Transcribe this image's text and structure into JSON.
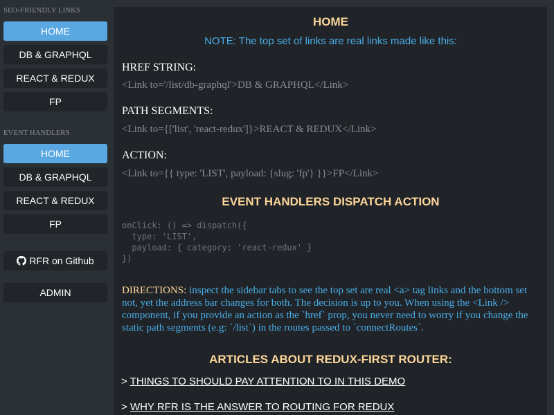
{
  "sidebar": {
    "seo_label": "SEO-FRIENDLY LINKS",
    "seo_links": [
      "HOME",
      "DB & GRAPHQL",
      "REACT & REDUX",
      "FP"
    ],
    "event_label": "EVENT HANDLERS",
    "event_links": [
      "HOME",
      "DB & GRAPHQL",
      "REACT & REDUX",
      "FP"
    ],
    "github_label": "RFR on Github",
    "github_icon": "github-icon",
    "admin_label": "ADMIN"
  },
  "main": {
    "title": "HOME",
    "note": "NOTE: The top set of links are real links made like this:",
    "href_label": "HREF STRING:",
    "href_code": "<Link to='/list/db-graphql'>DB & GRAPHQL</Link>",
    "path_label": "PATH SEGMENTS:",
    "path_code": "<Link to={['list', 'react-redux']}>REACT & REDUX</Link>",
    "action_label": "ACTION:",
    "action_code": "<Link to={{ type: 'LIST', payload: {slug: 'fp'} }}>FP</Link>",
    "dispatch_title": "EVENT HANDLERS DISPATCH ACTION",
    "dispatch_code": "onClick: () => dispatch({\n  type: 'LIST',\n  payload: { category: 'react-redux' }\n})",
    "directions_label": "DIRECTIONS:",
    "directions_text": "inspect the sidebar tabs to see the top set are real <a> tag links and the bottom set not, yet the address bar changes for both. The decision is up to you. When using the <Link /> component, if you provide an action as the `href` prop, you never need to worry if you change the static path segments (e.g: `/list`) in the routes passed to `connectRoutes`.",
    "articles_title": "ARTICLES ABOUT REDUX-FIRST ROUTER:",
    "articles": [
      {
        "prefix": "> ",
        "text": "THINGS TO SHOULD PAY ATTENTION TO IN THIS DEMO"
      },
      {
        "prefix": "> ",
        "text": "WHY RFR IS THE ANSWER TO ROUTING FOR REDUX"
      }
    ]
  },
  "colors": {
    "active": "#5aa8e1",
    "heading": "#fdd69a",
    "accent_blue": "#4aaee8"
  }
}
